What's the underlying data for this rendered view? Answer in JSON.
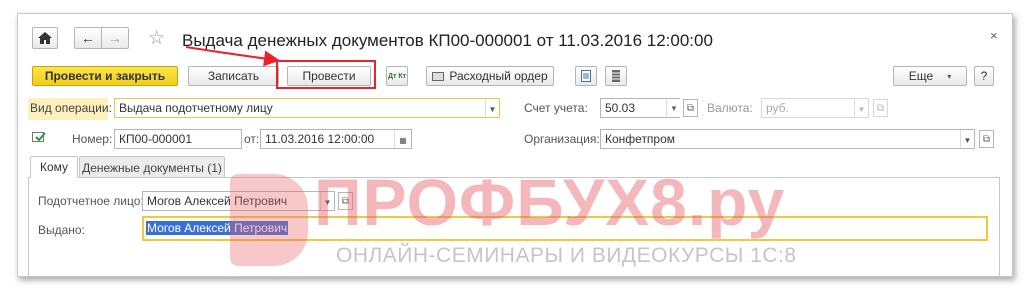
{
  "title": "Выдача денежных документов КП00-000001 от 11.03.2016 12:00:00",
  "toolbar": {
    "post_close": "Провести и закрыть",
    "write": "Записать",
    "post": "Провести",
    "dt_kt": "Дт Кт",
    "expense_order": "Расходный ордер",
    "more": "Еще",
    "help": "?"
  },
  "form": {
    "operation_label": "Вид операции:",
    "operation_value": "Выдача подотчетному лицу",
    "account_label": "Счет учета:",
    "account_value": "50.03",
    "currency_label": "Валюта:",
    "currency_value": "руб.",
    "number_label": "Номер:",
    "number_value": "КП00-000001",
    "date_label": "от:",
    "date_value": "11.03.2016 12:00:00",
    "org_label": "Организация:",
    "org_value": "Конфетпром"
  },
  "tabs": [
    {
      "label": "Кому"
    },
    {
      "label": "Денежные документы (1)"
    }
  ],
  "tab_content": {
    "person_label": "Подотчетное лицо:",
    "person_value": "Могов Алексей Петрович",
    "issued_label": "Выдано:",
    "issued_value": "Могов Алексей Петрович"
  },
  "watermark": {
    "main": "ПРОФБУХ8.ру",
    "sub": "ОНЛАЙН-СЕМИНАРЫ И ВИДЕОКУРСЫ 1С:8"
  },
  "colors": {
    "accent_yellow": "#f5d225",
    "highlight_red": "#e8242a",
    "watermark_red": "#e76068",
    "selection": "#3a6fd8"
  }
}
